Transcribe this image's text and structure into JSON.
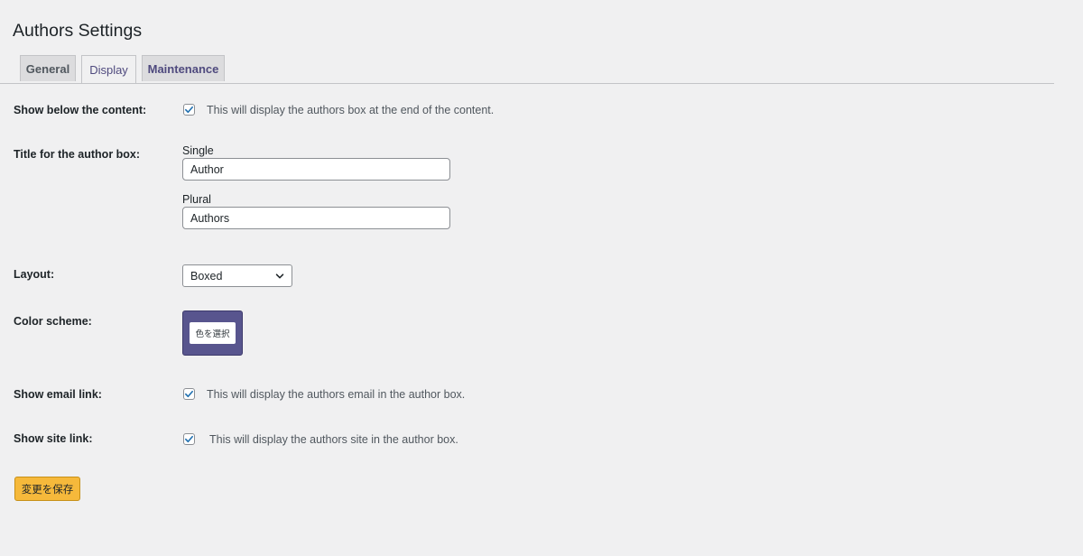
{
  "page": {
    "title": "Authors Settings"
  },
  "tabs": [
    {
      "label": "General"
    },
    {
      "label": "Display"
    },
    {
      "label": "Maintenance"
    }
  ],
  "settings": {
    "show_below_content": {
      "label": "Show below the content:",
      "checked": true,
      "description": "This will display the authors box at the end of the content."
    },
    "title_box": {
      "label": "Title for the author box:",
      "single_label": "Single",
      "single_value": "Author",
      "plural_label": "Plural",
      "plural_value": "Authors"
    },
    "layout": {
      "label": "Layout:",
      "selected": "Boxed"
    },
    "color_scheme": {
      "label": "Color scheme:",
      "button_label": "色を選択",
      "color": "#58558e"
    },
    "show_email": {
      "label": "Show email link:",
      "checked": true,
      "description": "This will display the authors email in the author box."
    },
    "show_site": {
      "label": "Show site link:",
      "checked": true,
      "description": "This will display the authors site in the author box."
    }
  },
  "save_button": {
    "label": "変更を保存",
    "color": "#f6b93b"
  },
  "colors": {
    "checkmark": "#2271b1",
    "background": "#f0f0f1"
  }
}
